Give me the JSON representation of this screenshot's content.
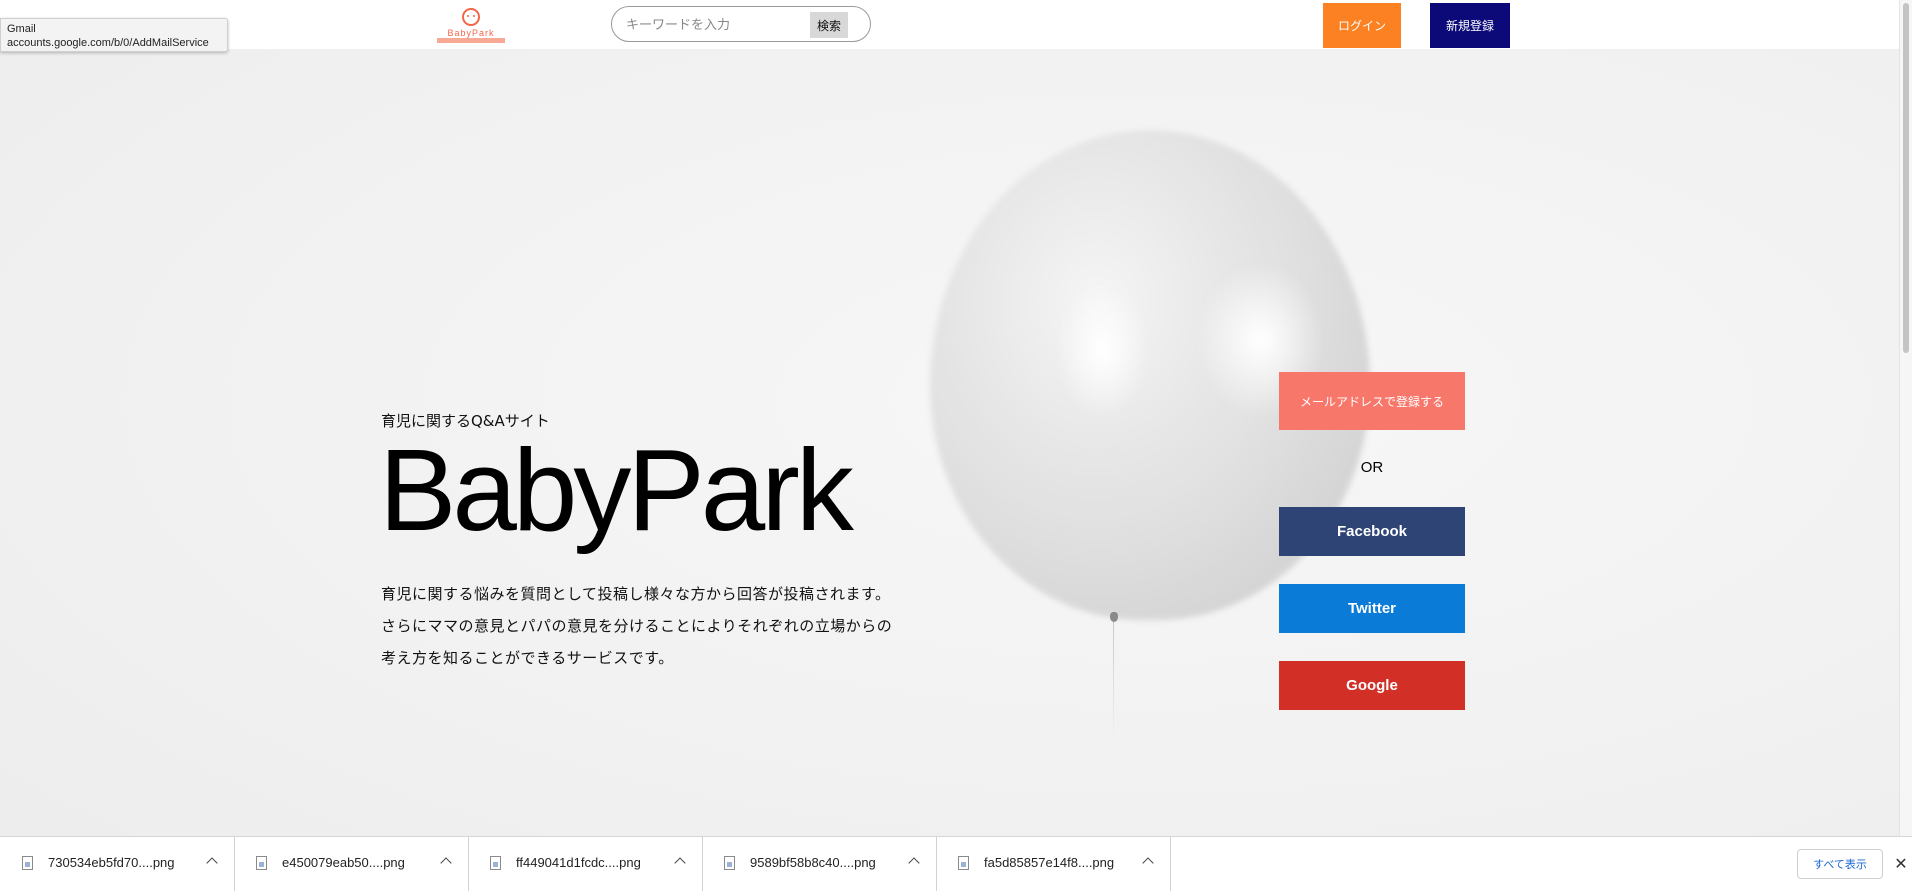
{
  "tooltip": {
    "line1": "Gmail",
    "line2": "accounts.google.com/b/0/AddMailService"
  },
  "header": {
    "logo_text": "BabyPark",
    "search": {
      "placeholder": "キーワードを入力",
      "value": "",
      "button_label": "検索"
    },
    "login_label": "ログイン",
    "signup_label": "新規登録"
  },
  "hero": {
    "subtitle": "育児に関するQ&Aサイト",
    "title": "BabyPark",
    "description": [
      "育児に関する悩みを質問として投稿し様々な方から回答が投稿されます。",
      "さらにママの意見とパパの意見を分けることによりそれぞれの立場からの",
      "考え方を知ることができるサービスです。"
    ]
  },
  "register": {
    "email_label": "メールアドレスで登録する",
    "or_label": "OR",
    "facebook_label": "Facebook",
    "twitter_label": "Twitter",
    "google_label": "Google"
  },
  "downloads": {
    "items": [
      {
        "name": "730534eb5fd70....png"
      },
      {
        "name": "e450079eab50....png"
      },
      {
        "name": "ff449041d1fcdc....png"
      },
      {
        "name": "9589bf58b8c40....png"
      },
      {
        "name": "fa5d85857e14f8....png"
      }
    ],
    "show_all_label": "すべて表示",
    "close_symbol": "✕"
  },
  "colors": {
    "login": "#fb8122",
    "signup": "#0c0a78",
    "email": "#f8776b",
    "facebook": "#2d4475",
    "twitter": "#0a7bd6",
    "google": "#d22f27",
    "logo": "#f4664a"
  }
}
